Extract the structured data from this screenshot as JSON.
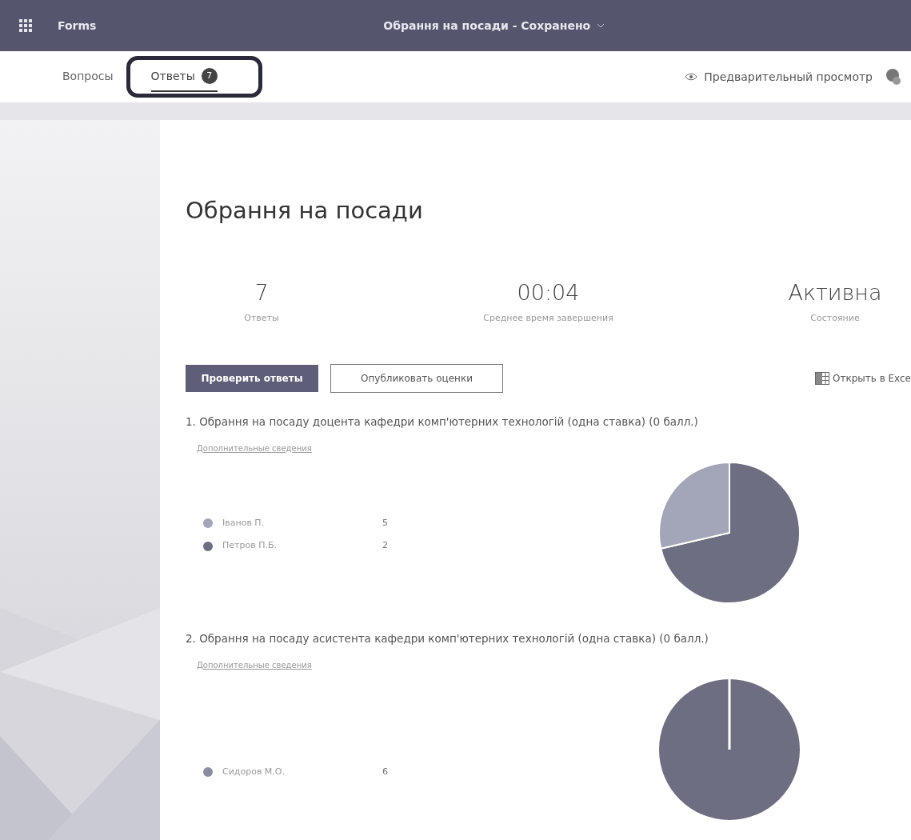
{
  "header": {
    "app_name": "Forms",
    "document_title": "Обрання на посади - Сохранено"
  },
  "tabs": [
    {
      "label": "Вопросы",
      "selected": false
    },
    {
      "label": "Ответы",
      "selected": true,
      "badge": "7"
    }
  ],
  "preview_link": "Предварительный просмотр",
  "form_title": "Обрання на посади",
  "stats": [
    {
      "value": "7",
      "label": "Ответы"
    },
    {
      "value": "00:04",
      "label": "Среднее время завершения"
    },
    {
      "value": "Активна",
      "label": "Состояние"
    }
  ],
  "actions": {
    "primary": "Проверить ответы",
    "secondary": "Опубликовать оценки",
    "excel": "Открыть в Exce"
  },
  "questions": [
    {
      "title": "1. Обрання на посаду доцента кафедри комп'ютерних технологій (одна ставка)  (0 балл.)",
      "details": "Дополнительные сведения",
      "options": [
        {
          "name": "Іванов П.",
          "count": "5",
          "color": "#a3a6b8"
        },
        {
          "name": "Петров П.Б.",
          "count": "2",
          "color": "#6e6e82"
        }
      ],
      "chart_data": {
        "type": "pie",
        "values": [
          71.4,
          28.6
        ]
      }
    },
    {
      "title": "2. Обрання на посаду асистента кафедри комп'ютерних технологій (одна ставка) (0 балл.)",
      "details": "Дополнительные сведения",
      "options": [
        {
          "name": "Сидоров М.О.",
          "count": "6",
          "color": "#8a8ca0"
        }
      ]
    }
  ]
}
